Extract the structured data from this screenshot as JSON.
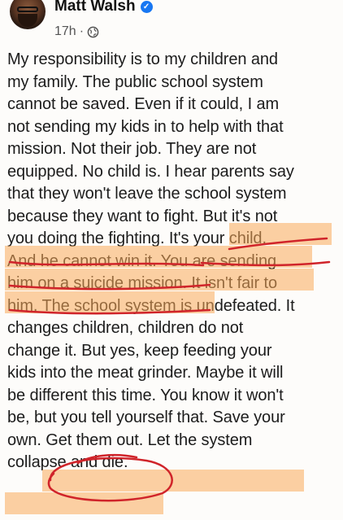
{
  "author": {
    "name": "Matt Walsh",
    "verified": true
  },
  "timestamp": "17h",
  "meta_separator": "·",
  "audience_icon": "globe-icon",
  "verified_icon": "verified-badge-icon",
  "post_lines": [
    "My responsibility is to my children and",
    "my family. The public school system",
    "cannot be saved. Even if it could, I am",
    "not sending my kids in to help with that",
    "mission. Not their job. They are not",
    "equipped. No child is. I hear parents say",
    "that they won't leave the school system",
    "because they want to fight. But it's not",
    "you doing the fighting. It's your child.",
    "And he cannot win it. You are sending",
    "him on a suicide mission. It isn't fair to",
    "him. The school system is undefeated. It",
    "changes children, children do not",
    "change it. But yes, keep feeding your",
    "kids into the meat grinder. Maybe it will",
    "be different this time. You know it won't",
    "be, but you tell yourself that. Save your",
    "own. Get them out. Let the system",
    "collapse and die."
  ],
  "colors": {
    "highlight": "#f7a95a",
    "ink": "#d0242a",
    "verified": "#1877f2"
  }
}
